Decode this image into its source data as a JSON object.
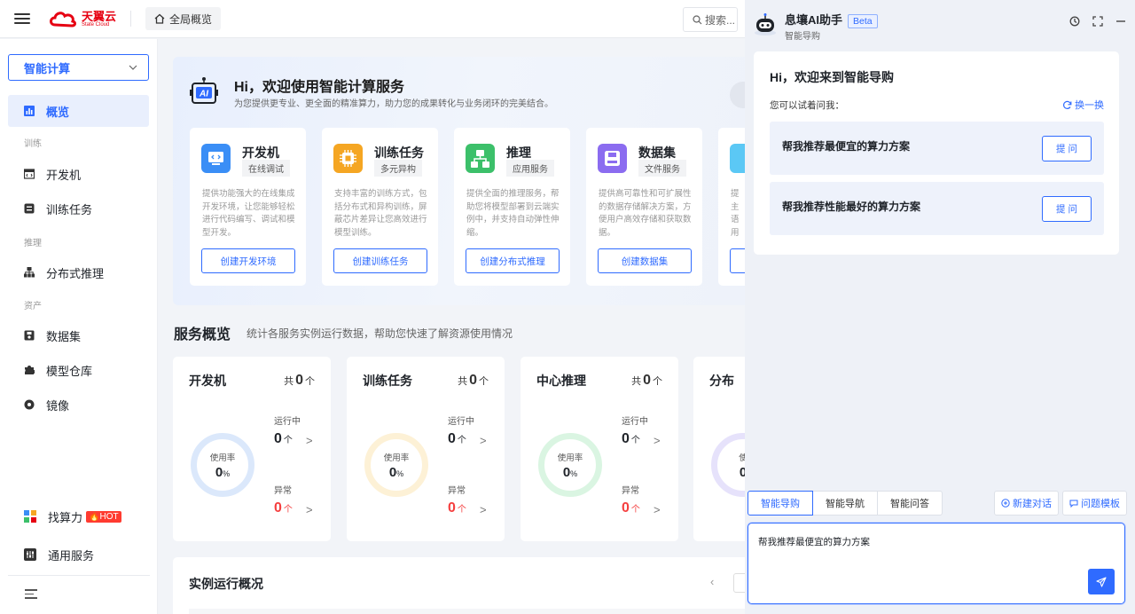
{
  "header": {
    "logo_cn": "天翼云",
    "logo_en": "State Cloud",
    "home_tab": "全局概览",
    "search_placeholder": "搜索..."
  },
  "sidebar": {
    "selector": "智能计算",
    "items": [
      {
        "label": "概览",
        "icon": "chart-icon",
        "active": true
      },
      {
        "group": "训练"
      },
      {
        "label": "开发机",
        "icon": "code-window-icon"
      },
      {
        "label": "训练任务",
        "icon": "task-icon"
      },
      {
        "group": "推理"
      },
      {
        "label": "分布式推理",
        "icon": "hierarchy-icon"
      },
      {
        "group": "资产"
      },
      {
        "label": "数据集",
        "icon": "dataset-icon"
      },
      {
        "label": "模型仓库",
        "icon": "puzzle-icon"
      },
      {
        "label": "镜像",
        "icon": "disc-icon"
      }
    ],
    "find_compute": "找算力",
    "hot": "HOT",
    "general": "通用服务"
  },
  "banner": {
    "title": "Hi，欢迎使用智能计算服务",
    "subtitle": "为您提供更专业、更全面的精准算力，助力您的成果转化与业务闭环的完美结合。",
    "cards": [
      {
        "title": "开发机",
        "tag": "在线调试",
        "desc": "提供功能强大的在线集成开发环境，让您能够轻松进行代码编写、调试和模型开发。",
        "button": "创建开发环境",
        "color": "#3a8ef6"
      },
      {
        "title": "训练任务",
        "tag": "多元异构",
        "desc": "支持丰富的训练方式，包括分布式和异构训练，屏蔽芯片差异让您高效进行模型训练。",
        "button": "创建训练任务",
        "color": "#f5a623"
      },
      {
        "title": "推理",
        "tag": "应用服务",
        "desc": "提供全面的推理服务，帮助您将模型部署到云端实例中，并支持自动弹性伸缩。",
        "button": "创建分布式推理",
        "color": "#3cc06a"
      },
      {
        "title": "数据集",
        "tag": "文件服务",
        "desc": "提供高可靠性和可扩展性的数据存储解决方案，方便用户高效存储和获取数据。",
        "button": "创建数据集",
        "color": "#8b6cf0"
      },
      {
        "title": "",
        "tag": "",
        "desc": "提主语用",
        "button": "",
        "color": "#5bc8f5"
      }
    ]
  },
  "overview": {
    "title": "服务概览",
    "subtitle": "统计各服务实例运行数据，帮助您快速了解资源使用情况",
    "cards": [
      {
        "title": "开发机",
        "total_prefix": "共",
        "total": "0",
        "total_unit": "个",
        "usage_label": "使用率",
        "usage": "0",
        "usage_unit": "%",
        "running_label": "运行中",
        "running": "0",
        "abnormal_label": "异常",
        "abnormal": "0",
        "unit": "个",
        "ring": "#dbe8fb"
      },
      {
        "title": "训练任务",
        "total_prefix": "共",
        "total": "0",
        "total_unit": "个",
        "usage_label": "使用率",
        "usage": "0",
        "usage_unit": "%",
        "running_label": "运行中",
        "running": "0",
        "abnormal_label": "异常",
        "abnormal": "0",
        "unit": "个",
        "ring": "#fdf1d6"
      },
      {
        "title": "中心推理",
        "total_prefix": "共",
        "total": "0",
        "total_unit": "个",
        "usage_label": "使用率",
        "usage": "0",
        "usage_unit": "%",
        "running_label": "运行中",
        "running": "0",
        "abnormal_label": "异常",
        "abnormal": "0",
        "unit": "个",
        "ring": "#daf5e2"
      },
      {
        "title": "分布",
        "total_prefix": "",
        "total": "",
        "total_unit": "",
        "usage_label": "使",
        "usage": "0",
        "usage_unit": "",
        "running_label": "",
        "running": "",
        "abnormal_label": "",
        "abnormal": "",
        "unit": "",
        "ring": "#e6e2fb"
      }
    ],
    "instance_title": "实例运行概况",
    "pager_prev": "‹"
  },
  "assistant": {
    "title": "息壤AI助手",
    "beta": "Beta",
    "subtitle": "智能导购",
    "greeting": "Hi，欢迎来到智能导购",
    "try_label": "您可以试着问我：",
    "swap": "换一换",
    "suggestions": [
      {
        "text": "帮我推荐最便宜的算力方案",
        "button": "提 问"
      },
      {
        "text": "帮我推荐性能最好的算力方案",
        "button": "提 问"
      }
    ],
    "tabs": [
      "智能导购",
      "智能导航",
      "智能问答"
    ],
    "new_chat": "新建对话",
    "templates": "问题模板",
    "input_value": "帮我推荐最便宜的算力方案"
  },
  "colors": {
    "accent": "#2f6bff",
    "danger": "#f53f3f",
    "brand": "#e60012"
  }
}
